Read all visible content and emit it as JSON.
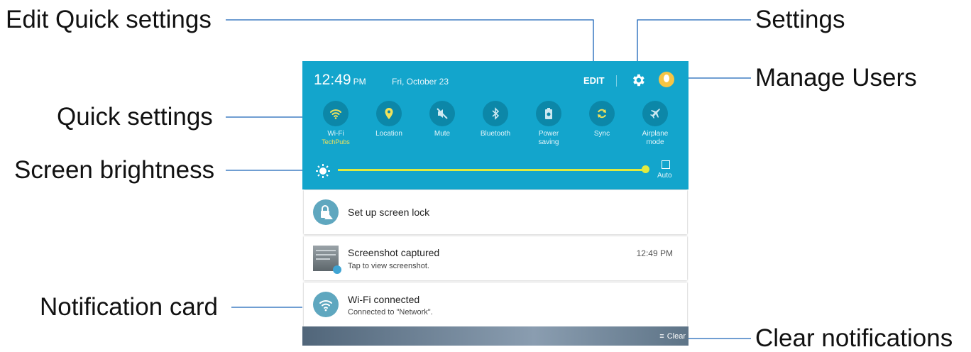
{
  "callouts": {
    "edit_quick_settings": "Edit Quick settings",
    "settings": "Settings",
    "manage_users": "Manage Users",
    "quick_settings": "Quick settings",
    "screen_brightness": "Screen brightness",
    "notification_card": "Notification card",
    "clear_notifications": "Clear notifications"
  },
  "header": {
    "time": "12:49",
    "ampm": "PM",
    "date": "Fri, October 23",
    "edit_label": "EDIT",
    "gear_icon": "gear-icon",
    "avatar_icon": "avatar"
  },
  "quick_settings": [
    {
      "label": "Wi-Fi",
      "sub": "TechPubs",
      "icon": "wifi-icon"
    },
    {
      "label": "Location",
      "sub": "",
      "icon": "location-icon"
    },
    {
      "label": "Mute",
      "sub": "",
      "icon": "mute-icon"
    },
    {
      "label": "Bluetooth",
      "sub": "",
      "icon": "bluetooth-icon"
    },
    {
      "label": "Power saving",
      "sub": "",
      "icon": "power-saving-icon"
    },
    {
      "label": "Sync",
      "sub": "",
      "icon": "sync-icon"
    },
    {
      "label": "Airplane mode",
      "sub": "",
      "icon": "airplane-icon"
    }
  ],
  "brightness": {
    "auto_label": "Auto",
    "level": 0.99
  },
  "notifications": [
    {
      "title": "Set up screen lock",
      "text": "",
      "time": "",
      "icon": "lock-icon"
    },
    {
      "title": "Screenshot captured",
      "text": "Tap to view screenshot.",
      "time": "12:49 PM",
      "icon": "screenshot-thumbnail"
    },
    {
      "title": "Wi-Fi connected",
      "text": "Connected to \"Network\".",
      "time": "",
      "icon": "wifi-icon"
    }
  ],
  "clear_label": "Clear",
  "colors": {
    "header": "#13a5cc",
    "icon_circle": "#0c87a8",
    "accent": "#e0ea3f",
    "leader": "#1565c0"
  }
}
